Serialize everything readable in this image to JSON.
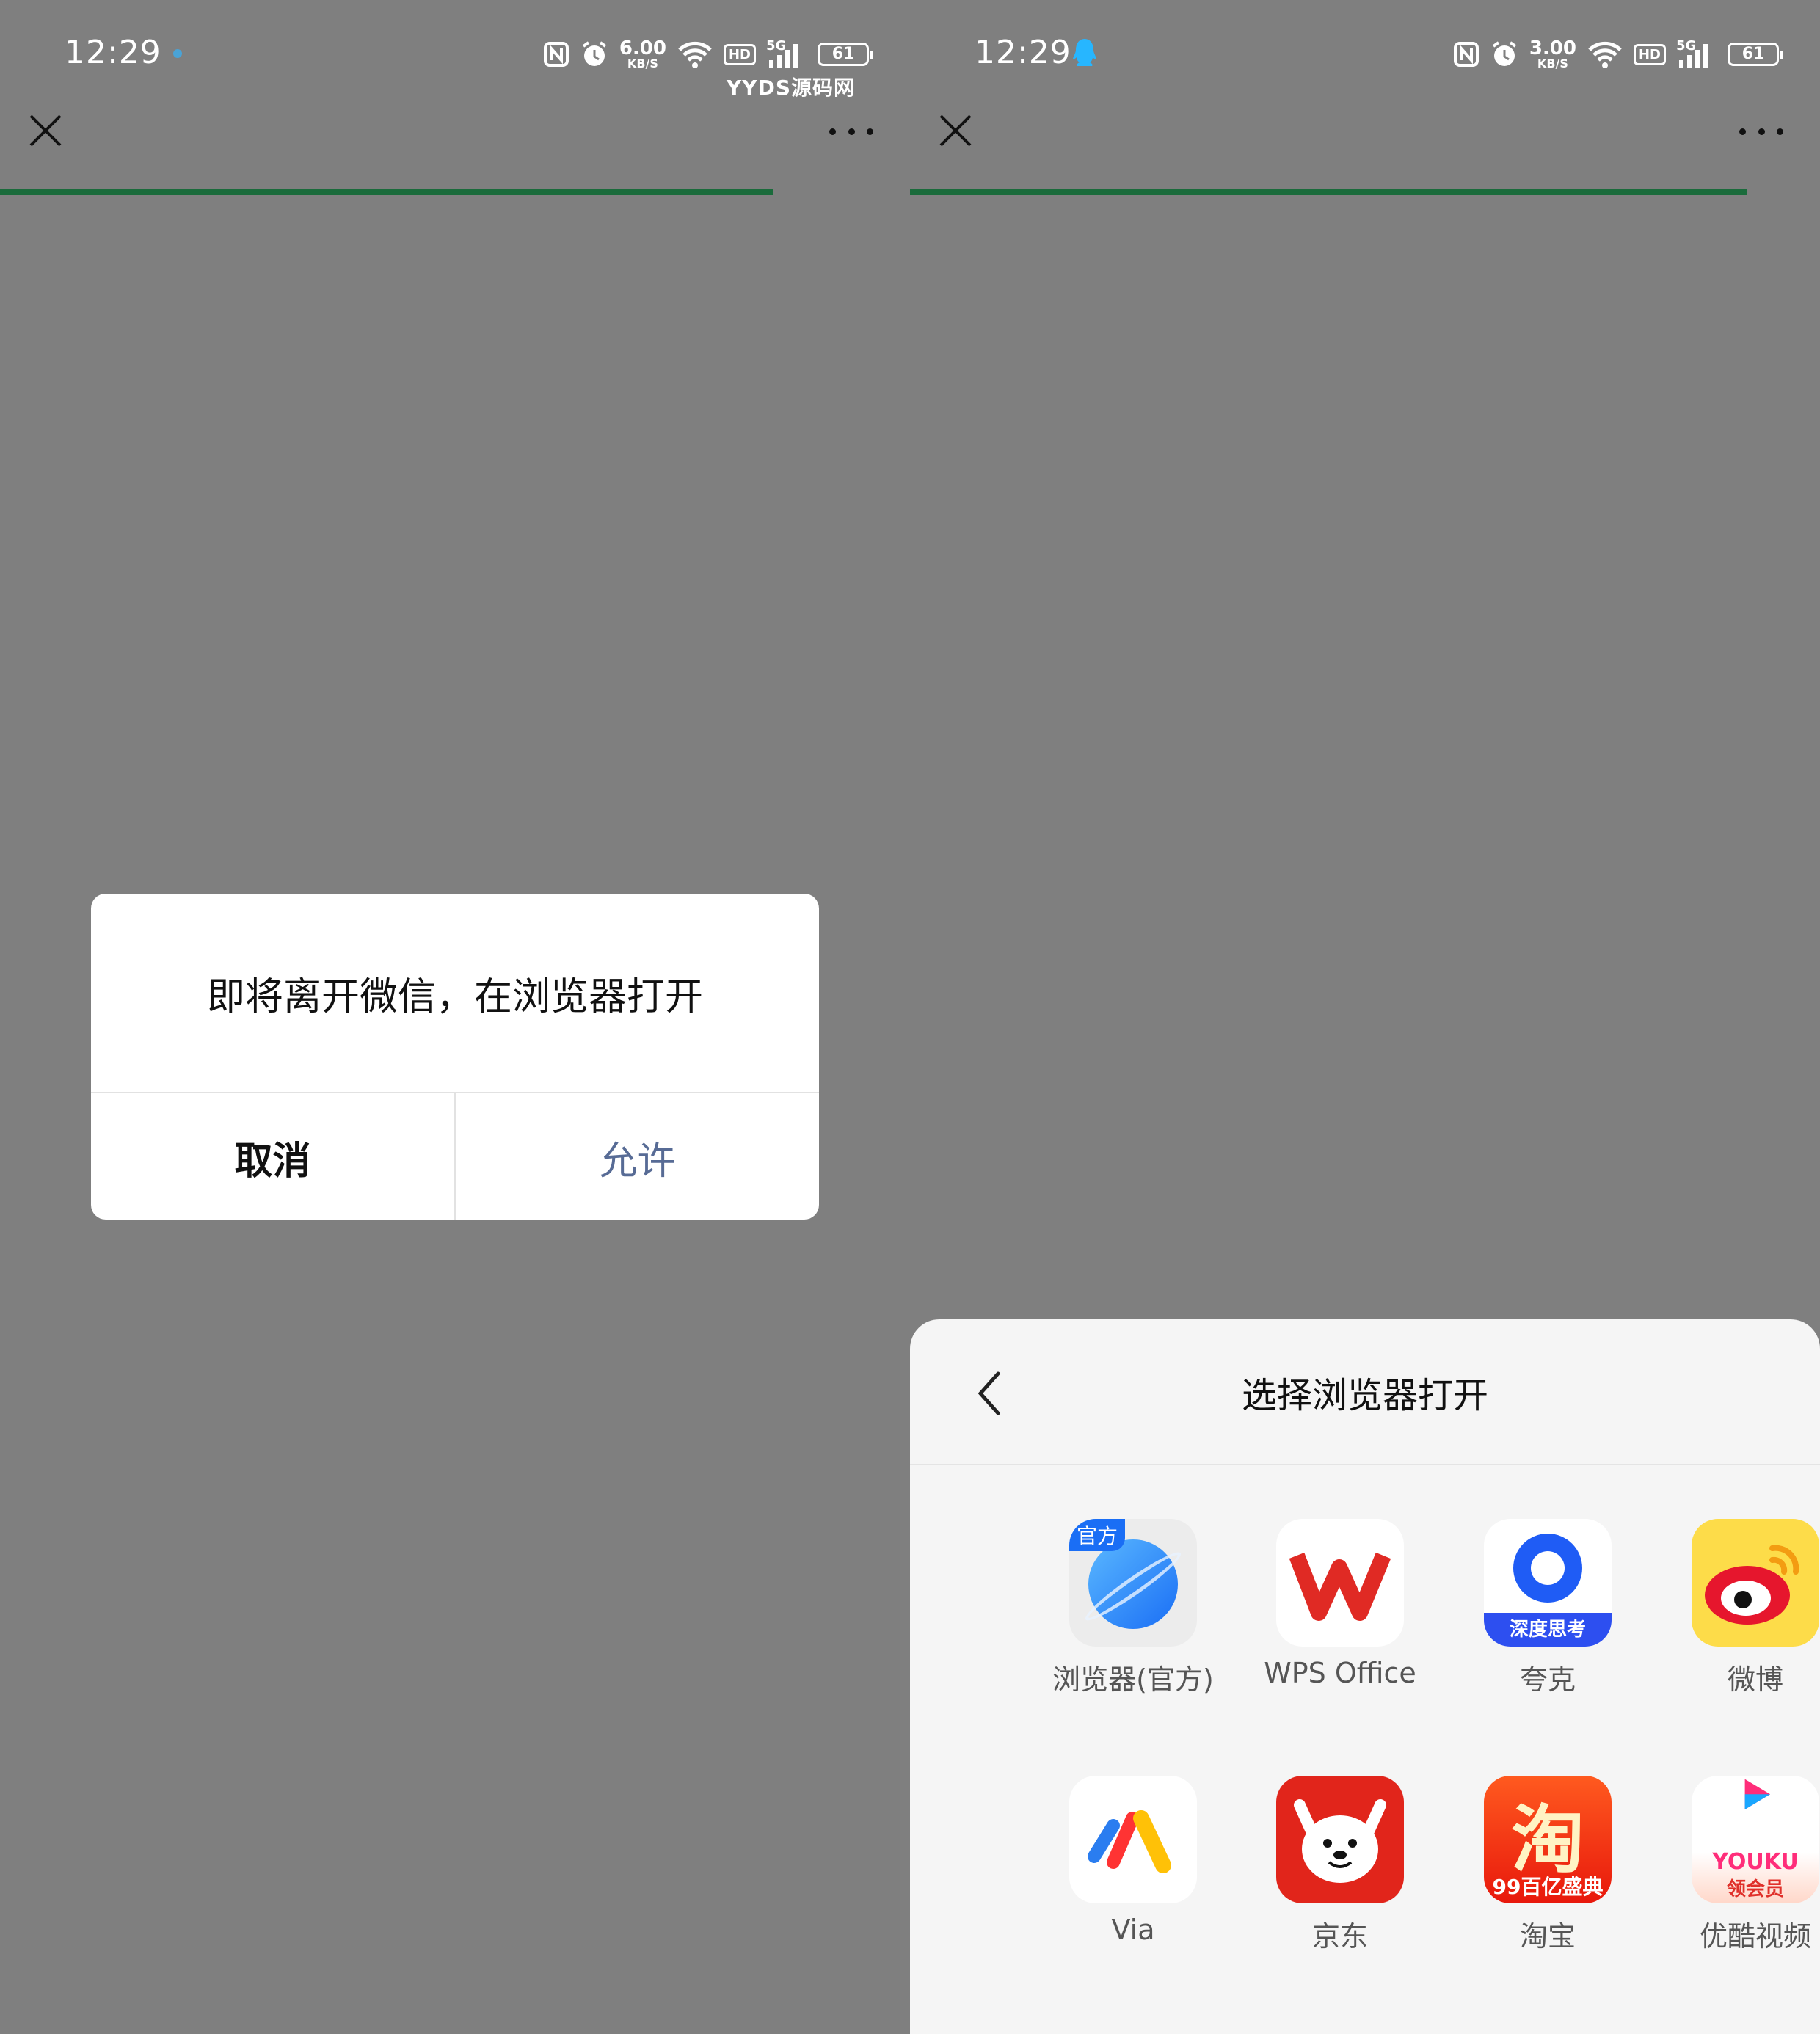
{
  "left": {
    "status": {
      "time": "12:29",
      "speed_value": "6.00",
      "speed_unit": "KB/S",
      "hd": "HD",
      "network": "5G",
      "battery": "61",
      "watermark": "YYDS源码网"
    },
    "progress": 0.85,
    "dialog": {
      "message": "即将离开微信，在浏览器打开",
      "cancel": "取消",
      "allow": "允许"
    }
  },
  "right": {
    "status": {
      "time": "12:29",
      "speed_value": "3.00",
      "speed_unit": "KB/S",
      "hd": "HD",
      "network": "5G",
      "battery": "61"
    },
    "progress": 0.92,
    "sheet": {
      "title": "选择浏览器打开",
      "apps": [
        {
          "label": "浏览器(官方)",
          "badge": "官方",
          "icon": "browser-official-icon"
        },
        {
          "label": "WPS Office",
          "icon": "wps-office-icon"
        },
        {
          "label": "夸克",
          "banner": "深度思考",
          "icon": "quark-icon"
        },
        {
          "label": "微博",
          "icon": "weibo-icon"
        },
        {
          "label": "Via",
          "icon": "via-icon"
        },
        {
          "label": "京东",
          "icon": "jd-icon"
        },
        {
          "label": "淘宝",
          "glyph": "淘",
          "banner": "99百亿盛典",
          "icon": "taobao-icon"
        },
        {
          "label": "优酷视频",
          "brand": "YOUKU",
          "banner": "领会员",
          "icon": "youku-icon"
        }
      ]
    }
  },
  "colors": {
    "progress": "#1a6b3b",
    "allow_text": "#576b95",
    "overlay": "#7f7f7f"
  }
}
